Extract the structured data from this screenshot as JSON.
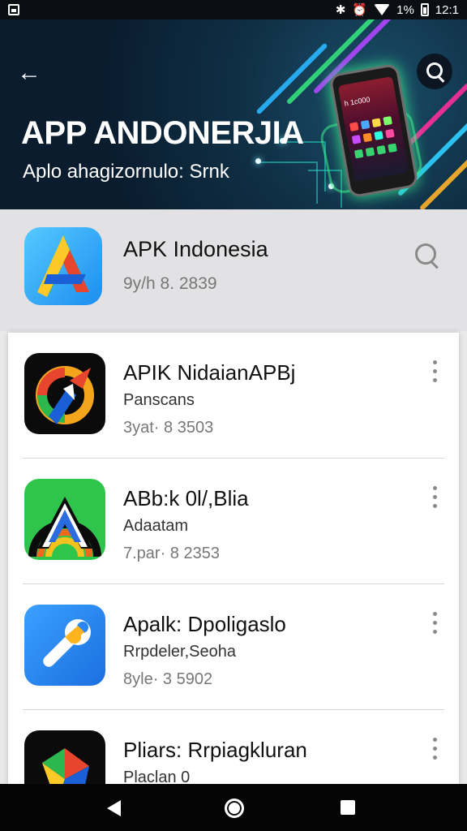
{
  "status_bar": {
    "time": "12:1",
    "battery_text": "1%"
  },
  "hero": {
    "title": "APP ANDONERJIA",
    "subtitle": "Aplo ahagizornulo: Srnk",
    "phone_screen_text": "h 1c000",
    "back_icon": "arrow-left-icon",
    "search_icon": "search-icon"
  },
  "featured": {
    "title": "APK Indonesia",
    "meta": "9y/h  8. 2839",
    "search_icon": "search-icon"
  },
  "list": {
    "items": [
      {
        "title": "APIK NidaianAPBj",
        "subtitle": "Panscans",
        "meta": "3yat·  8  3503"
      },
      {
        "title": "ABb:k 0l/,Blia",
        "subtitle": "Adaatam",
        "meta": "7.par·  8  2353"
      },
      {
        "title": "Apalk: Dpoligaslo",
        "subtitle": "Rrpdeler,Seoha",
        "meta": "8yle·  3  5902"
      },
      {
        "title": "Pliars: Rrpiagkluran",
        "subtitle": "Placlan  0",
        "meta": ""
      }
    ]
  },
  "colors": {
    "hero_bg": "#0f2f45",
    "accent_green": "#3cf08a",
    "accent_blue": "#1c8ef0"
  },
  "nav": {
    "back_icon": "nav-back-icon",
    "home_icon": "nav-home-icon",
    "recent_icon": "nav-recent-icon"
  }
}
